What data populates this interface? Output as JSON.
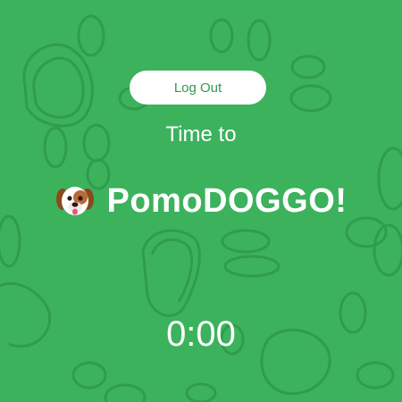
{
  "colors": {
    "background": "#3cb25d",
    "pattern": "#2f9a4b",
    "button_bg": "#ffffff",
    "button_text": "#2f9a4b",
    "text": "#ffffff"
  },
  "header": {
    "logout_label": "Log Out"
  },
  "main": {
    "subtitle": "Time to",
    "title_icon": "dog-face-icon",
    "title": "PomoDOGGO!",
    "timer": "0:00"
  },
  "background": {
    "pattern_icon": "paw-print-doodle"
  }
}
